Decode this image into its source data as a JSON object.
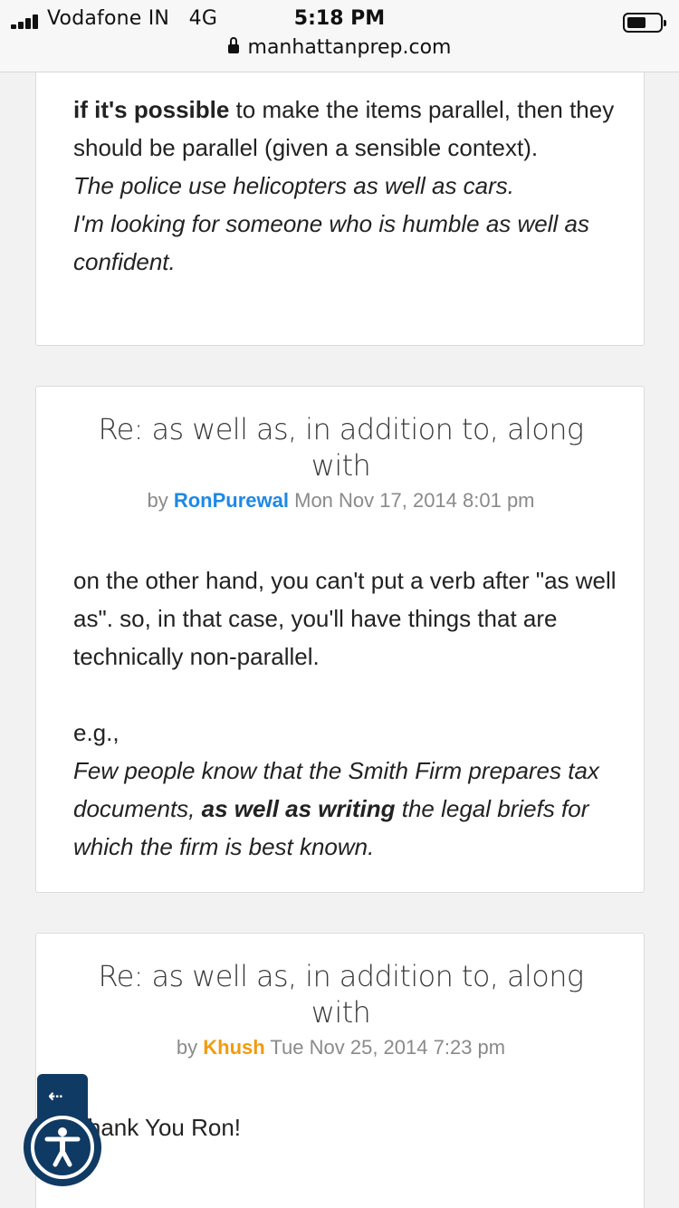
{
  "status_bar": {
    "carrier": "Vodafone IN",
    "network": "4G",
    "time": "5:18 PM",
    "url": "manhattanprep.com"
  },
  "posts": [
    {
      "body": {
        "bold_lead": "if it's possible",
        "line_rest": " to make the items parallel, then they should be parallel (given a sensible context).",
        "example1": "The police use helicopters as well as cars.",
        "example2": "I'm looking for someone who is humble as well as confident."
      }
    },
    {
      "title": "Re: as well as, in addition to, along with",
      "by": "by",
      "author": "RonPurewal",
      "date": "Mon Nov 17, 2014 8:01 pm",
      "body": {
        "p1": "on the other hand, you can't put a verb after \"as well as\". so, in that case, you'll have things that are technically non-parallel.",
        "eg": "e.g.,",
        "example_pre": "Few people know that the Smith Firm prepares tax documents, ",
        "example_bold": "as well as writing",
        "example_post": " the legal briefs for which the firm is best known."
      }
    },
    {
      "title": "Re: as well as, in addition to, along with",
      "by": "by",
      "author": "Khush",
      "date": "Tue Nov 25, 2014 7:23 pm",
      "body": {
        "p1": "Thank You Ron!"
      }
    }
  ],
  "widgets": {
    "back_icon": "arrow-left-icon",
    "back_glyph": "⇠",
    "accessibility_icon": "accessibility-icon"
  },
  "colors": {
    "ron_author": "#1e88e5",
    "khush_author": "#f29b0c",
    "widget_bg": "#0f3a63"
  }
}
